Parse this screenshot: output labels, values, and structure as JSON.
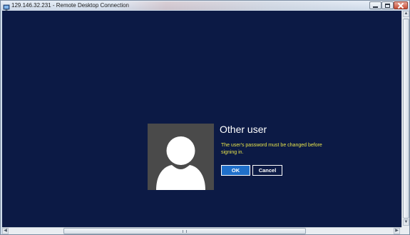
{
  "window": {
    "title": "129.146.32.231 - Remote Desktop Connection",
    "app_icon": "remote-desktop-icon",
    "controls": {
      "minimize": "minimize-icon",
      "maximize": "maximize-icon",
      "close": "close-icon"
    }
  },
  "login": {
    "user_name": "Other user",
    "message": "The user's password must be changed before signing in.",
    "ok_label": "OK",
    "cancel_label": "Cancel",
    "avatar_icon": "user-avatar-icon"
  },
  "colors": {
    "screen_background": "#0c1a45",
    "message_text": "#e6e24a",
    "ok_button": "#1f6fc9",
    "avatar_tile": "#4a4a4a"
  }
}
